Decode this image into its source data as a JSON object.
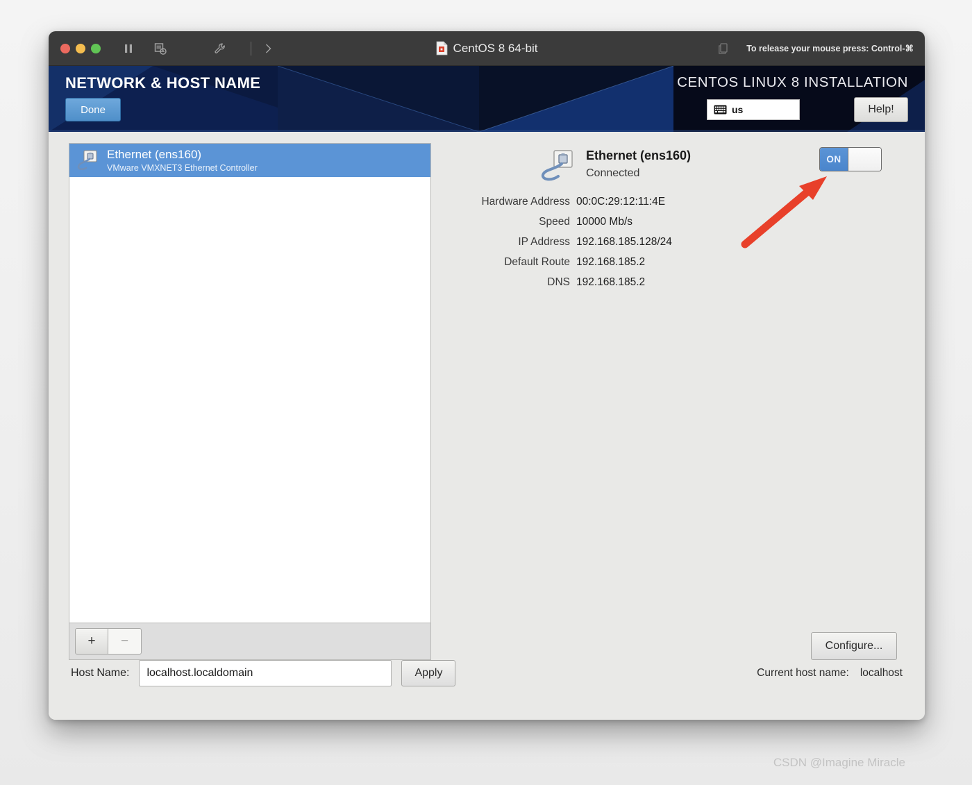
{
  "titlebar": {
    "title": "CentOS 8 64-bit",
    "release_hint": "To release your mouse press: Control-⌘",
    "icons": [
      "pause-icon",
      "snapshot-icon",
      "wrench-icon",
      "chevron-right-icon",
      "screen-icon"
    ]
  },
  "header": {
    "screen_title": "NETWORK & HOST NAME",
    "done_label": "Done",
    "install_title": "CENTOS LINUX 8 INSTALLATION",
    "keyboard_layout": "us",
    "help_label": "Help!"
  },
  "device_list": {
    "items": [
      {
        "name": "Ethernet (ens160)",
        "subtitle": "VMware VMXNET3 Ethernet Controller",
        "selected": true
      }
    ],
    "add_label": "+",
    "remove_label": "−"
  },
  "detail": {
    "name": "Ethernet (ens160)",
    "state": "Connected",
    "toggle_state": "ON",
    "rows": [
      {
        "label": "Hardware Address",
        "value": "00:0C:29:12:11:4E"
      },
      {
        "label": "Speed",
        "value": "10000 Mb/s"
      },
      {
        "label": "IP Address",
        "value": "192.168.185.128/24"
      },
      {
        "label": "Default Route",
        "value": "192.168.185.2"
      },
      {
        "label": "DNS",
        "value": "192.168.185.2"
      }
    ],
    "configure_label": "Configure..."
  },
  "hostname": {
    "label": "Host Name:",
    "value": "localhost.localdomain",
    "apply_label": "Apply",
    "current_label": "Current host name:",
    "current_value": "localhost"
  },
  "annotation": {
    "arrow_color": "#e8402a"
  },
  "watermark": "CSDN @Imagine Miracle"
}
